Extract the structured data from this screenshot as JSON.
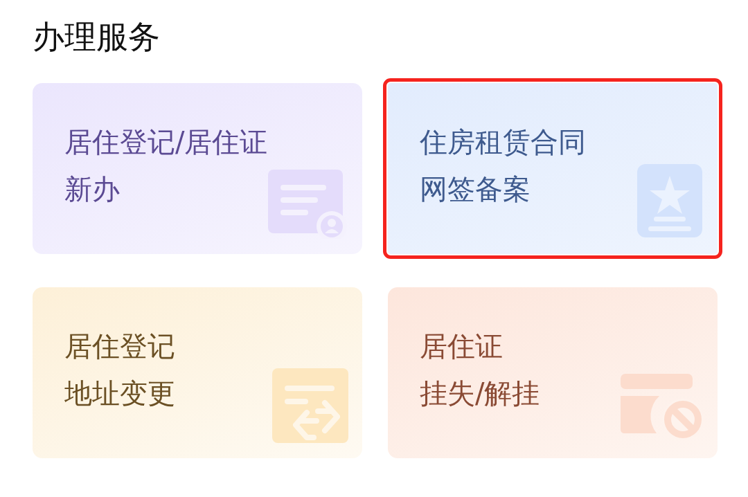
{
  "section_title": "办理服务",
  "cards": [
    {
      "kind": "person-card",
      "lines": [
        "居住登记/居住证",
        "新办"
      ],
      "highlighted": false
    },
    {
      "kind": "star-document",
      "lines": [
        "住房租赁合同",
        "网签备案"
      ],
      "highlighted": true
    },
    {
      "kind": "swap-document",
      "lines": [
        "居住登记",
        "地址变更"
      ],
      "highlighted": false
    },
    {
      "kind": "blocked-card",
      "lines": [
        "居住证",
        "挂失/解挂"
      ],
      "highlighted": false
    }
  ]
}
